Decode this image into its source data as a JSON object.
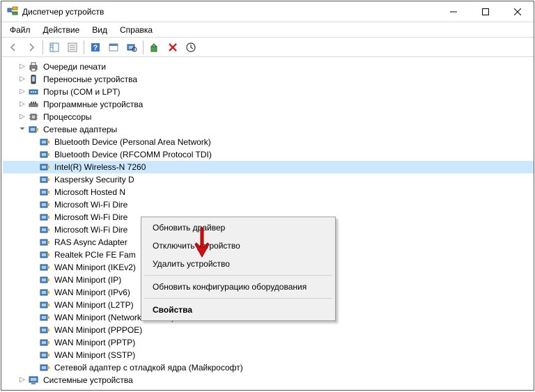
{
  "title": "Диспетчер устройств",
  "menubar": {
    "file": "Файл",
    "action": "Действие",
    "view": "Вид",
    "help": "Справка"
  },
  "tree": {
    "cat_print": "Очереди печати",
    "cat_portable": "Переносные устройства",
    "cat_ports": "Порты (COM и LPT)",
    "cat_software": "Программные устройства",
    "cat_cpu": "Процессоры",
    "cat_net": "Сетевые адаптеры",
    "net": {
      "bt_pan": "Bluetooth Device (Personal Area Network)",
      "bt_rfcomm": "Bluetooth Device (RFCOMM Protocol TDI)",
      "intel": "Intel(R) Wireless-N 7260",
      "kaspersky": "Kaspersky Security D",
      "ms_hosted": "Microsoft Hosted N",
      "ms_wifi1": "Microsoft Wi-Fi Dire",
      "ms_wifi2": "Microsoft Wi-Fi Dire",
      "ms_wifi3": "Microsoft Wi-Fi Dire",
      "ras": "RAS Async Adapter",
      "realtek": "Realtek PCIe FE Fam",
      "wan_ikev2": "WAN Miniport (IKEv2)",
      "wan_ip": "WAN Miniport (IP)",
      "wan_ipv6": "WAN Miniport (IPv6)",
      "wan_l2tp": "WAN Miniport (L2TP)",
      "wan_monitor": "WAN Miniport (Network Monitor)",
      "wan_pppoe": "WAN Miniport (PPPOE)",
      "wan_pptp": "WAN Miniport (PPTP)",
      "wan_sstp": "WAN Miniport (SSTP)",
      "kernel_dbg": "Сетевой адаптер с отладкой ядра (Майкрософт)"
    },
    "cat_sys": "Системные устройства"
  },
  "context": {
    "update": "Обновить драйвер",
    "disable": "Отключить устройство",
    "uninstall": "Удалить устройство",
    "scan": "Обновить конфигурацию оборудования",
    "properties": "Свойства"
  }
}
